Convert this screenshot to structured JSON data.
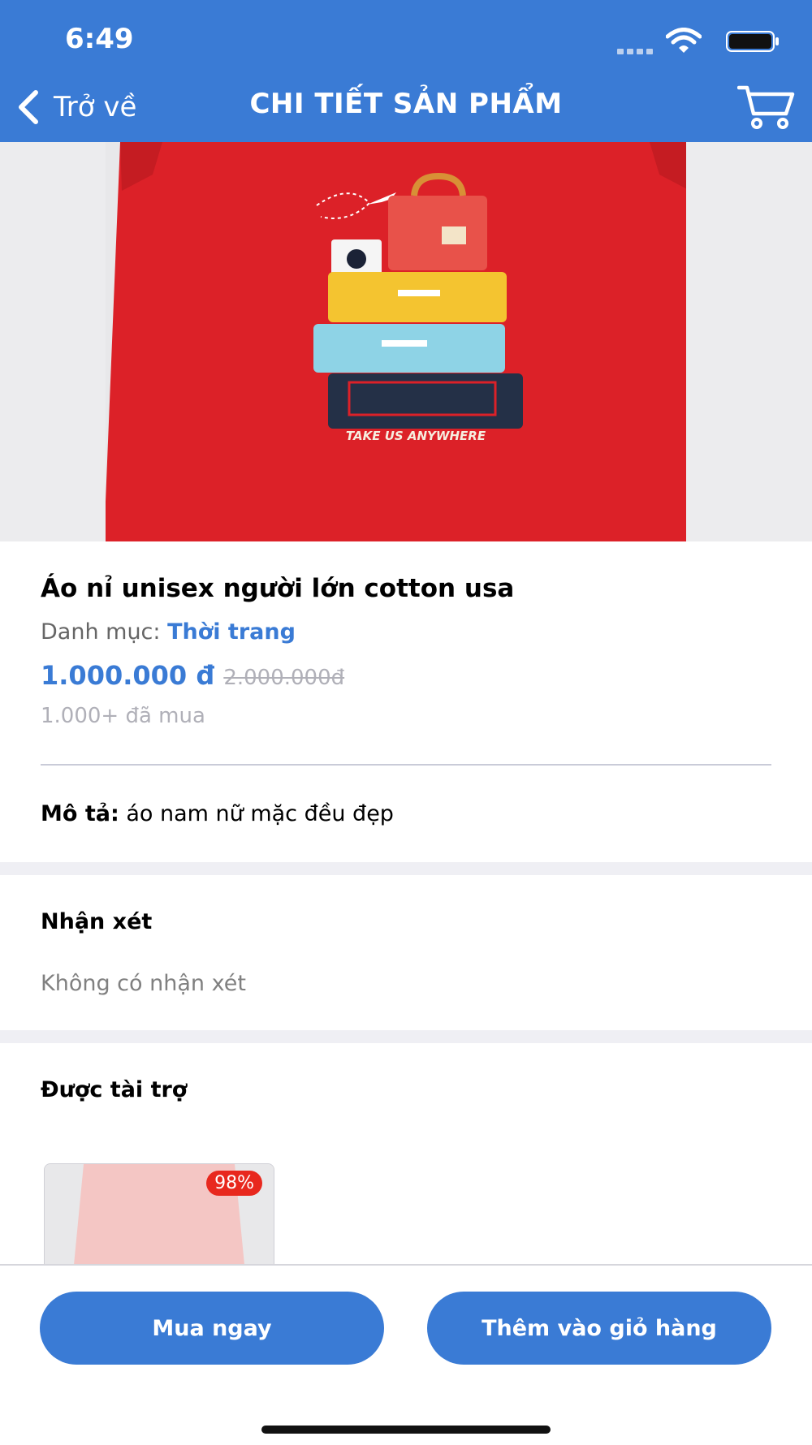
{
  "status_bar": {
    "time": "6:49"
  },
  "header": {
    "back_label": "Trở về",
    "title": "CHI TIẾT SẢN PHẨM"
  },
  "product": {
    "name": "Áo nỉ unisex người lớn cotton usa",
    "category_label": "Danh mục:",
    "category": "Thời trang",
    "price": "1.000.000 đ",
    "old_price": "2.000.000đ",
    "sold": "1.000+ đã mua",
    "description_label": "Mô tả:",
    "description": "áo nam nữ mặc đều đẹp",
    "print_text": "TAKE US ANYWHERE"
  },
  "reviews": {
    "title": "Nhận xét",
    "empty_text": "Không có nhận xét"
  },
  "sponsored": {
    "title": "Được tài trợ",
    "items": [
      {
        "discount": "98%"
      }
    ]
  },
  "footer": {
    "buy_now": "Mua ngay",
    "add_to_cart": "Thêm vào giỏ hàng"
  },
  "colors": {
    "primary": "#3a7bd5",
    "discount": "#e8281e",
    "shirt": "#dc2128"
  }
}
